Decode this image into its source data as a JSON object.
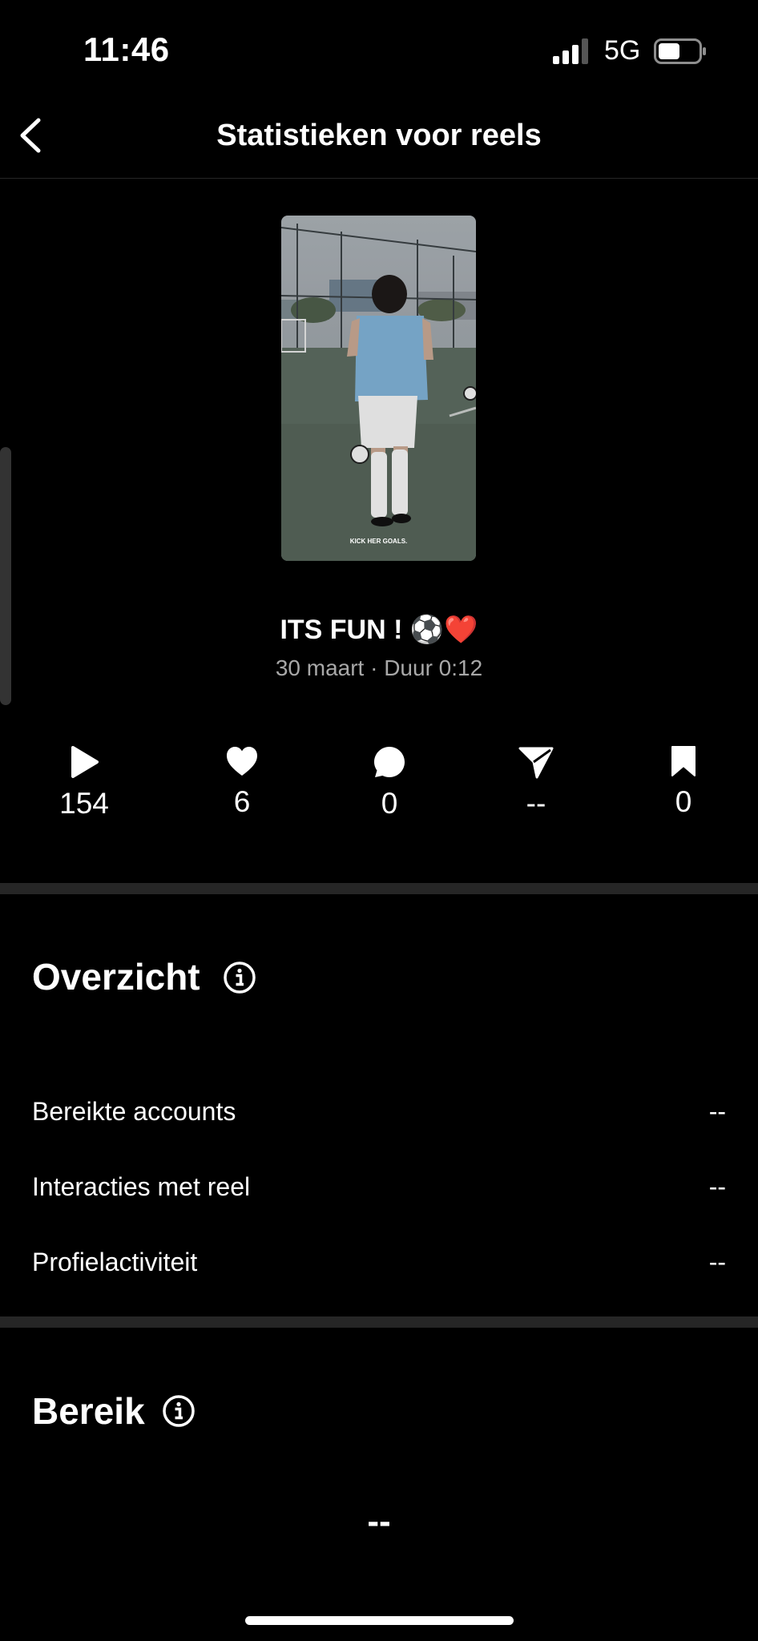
{
  "status_bar": {
    "time": "11:46",
    "network": "5G"
  },
  "nav": {
    "title": "Statistieken voor reels"
  },
  "reel": {
    "caption": "ITS FUN !",
    "caption_emoji": "⚽️❤️",
    "overlay_text": "KICK HER GOALS.",
    "meta": "30 maart · Duur 0:12"
  },
  "stats": {
    "plays": "154",
    "likes": "6",
    "comments": "0",
    "shares": "--",
    "saves": "0"
  },
  "overview": {
    "title": "Overzicht",
    "rows": [
      {
        "label": "Bereikte accounts",
        "value": "--"
      },
      {
        "label": "Interacties met reel",
        "value": "--"
      },
      {
        "label": "Profielactiviteit",
        "value": "--"
      }
    ]
  },
  "reach": {
    "title": "Bereik",
    "value": "--"
  }
}
